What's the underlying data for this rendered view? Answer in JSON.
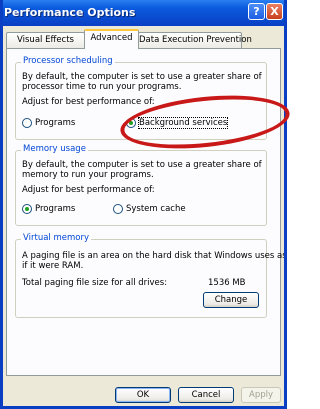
{
  "window": {
    "title": "Performance Options",
    "help_label": "?",
    "close_label": "X"
  },
  "tabs": [
    {
      "label": "Visual Effects"
    },
    {
      "label": "Advanced"
    },
    {
      "label": "Data Execution Prevention"
    }
  ],
  "active_tab": "Advanced",
  "processor_scheduling": {
    "title": "Processor scheduling",
    "description_line1": "By default, the computer is set to use a greater share of",
    "description_line2": "processor time to run your programs.",
    "adjust_label": "Adjust for best performance of:",
    "options": [
      {
        "label": "Programs",
        "checked": false
      },
      {
        "label": "Background services",
        "checked": true
      }
    ]
  },
  "memory_usage": {
    "title": "Memory usage",
    "description_line1": "By default, the computer is set to use a greater share of",
    "description_line2": "memory to run your programs.",
    "adjust_label": "Adjust for best performance of:",
    "options": [
      {
        "label": "Programs",
        "checked": true
      },
      {
        "label": "System cache",
        "checked": false
      }
    ]
  },
  "virtual_memory": {
    "title": "Virtual memory",
    "description_line1": "A paging file is an area on the hard disk that Windows uses as",
    "description_line2": "if it were RAM.",
    "total_label": "Total paging file size for all drives:",
    "total_value": "1536 MB",
    "change_label": "Change"
  },
  "buttons": {
    "ok": "OK",
    "cancel": "Cancel",
    "apply": "Apply"
  },
  "colors": {
    "annotation": "#c81818",
    "group_title": "#0046d5",
    "titlebar": "#0a4bd0"
  }
}
